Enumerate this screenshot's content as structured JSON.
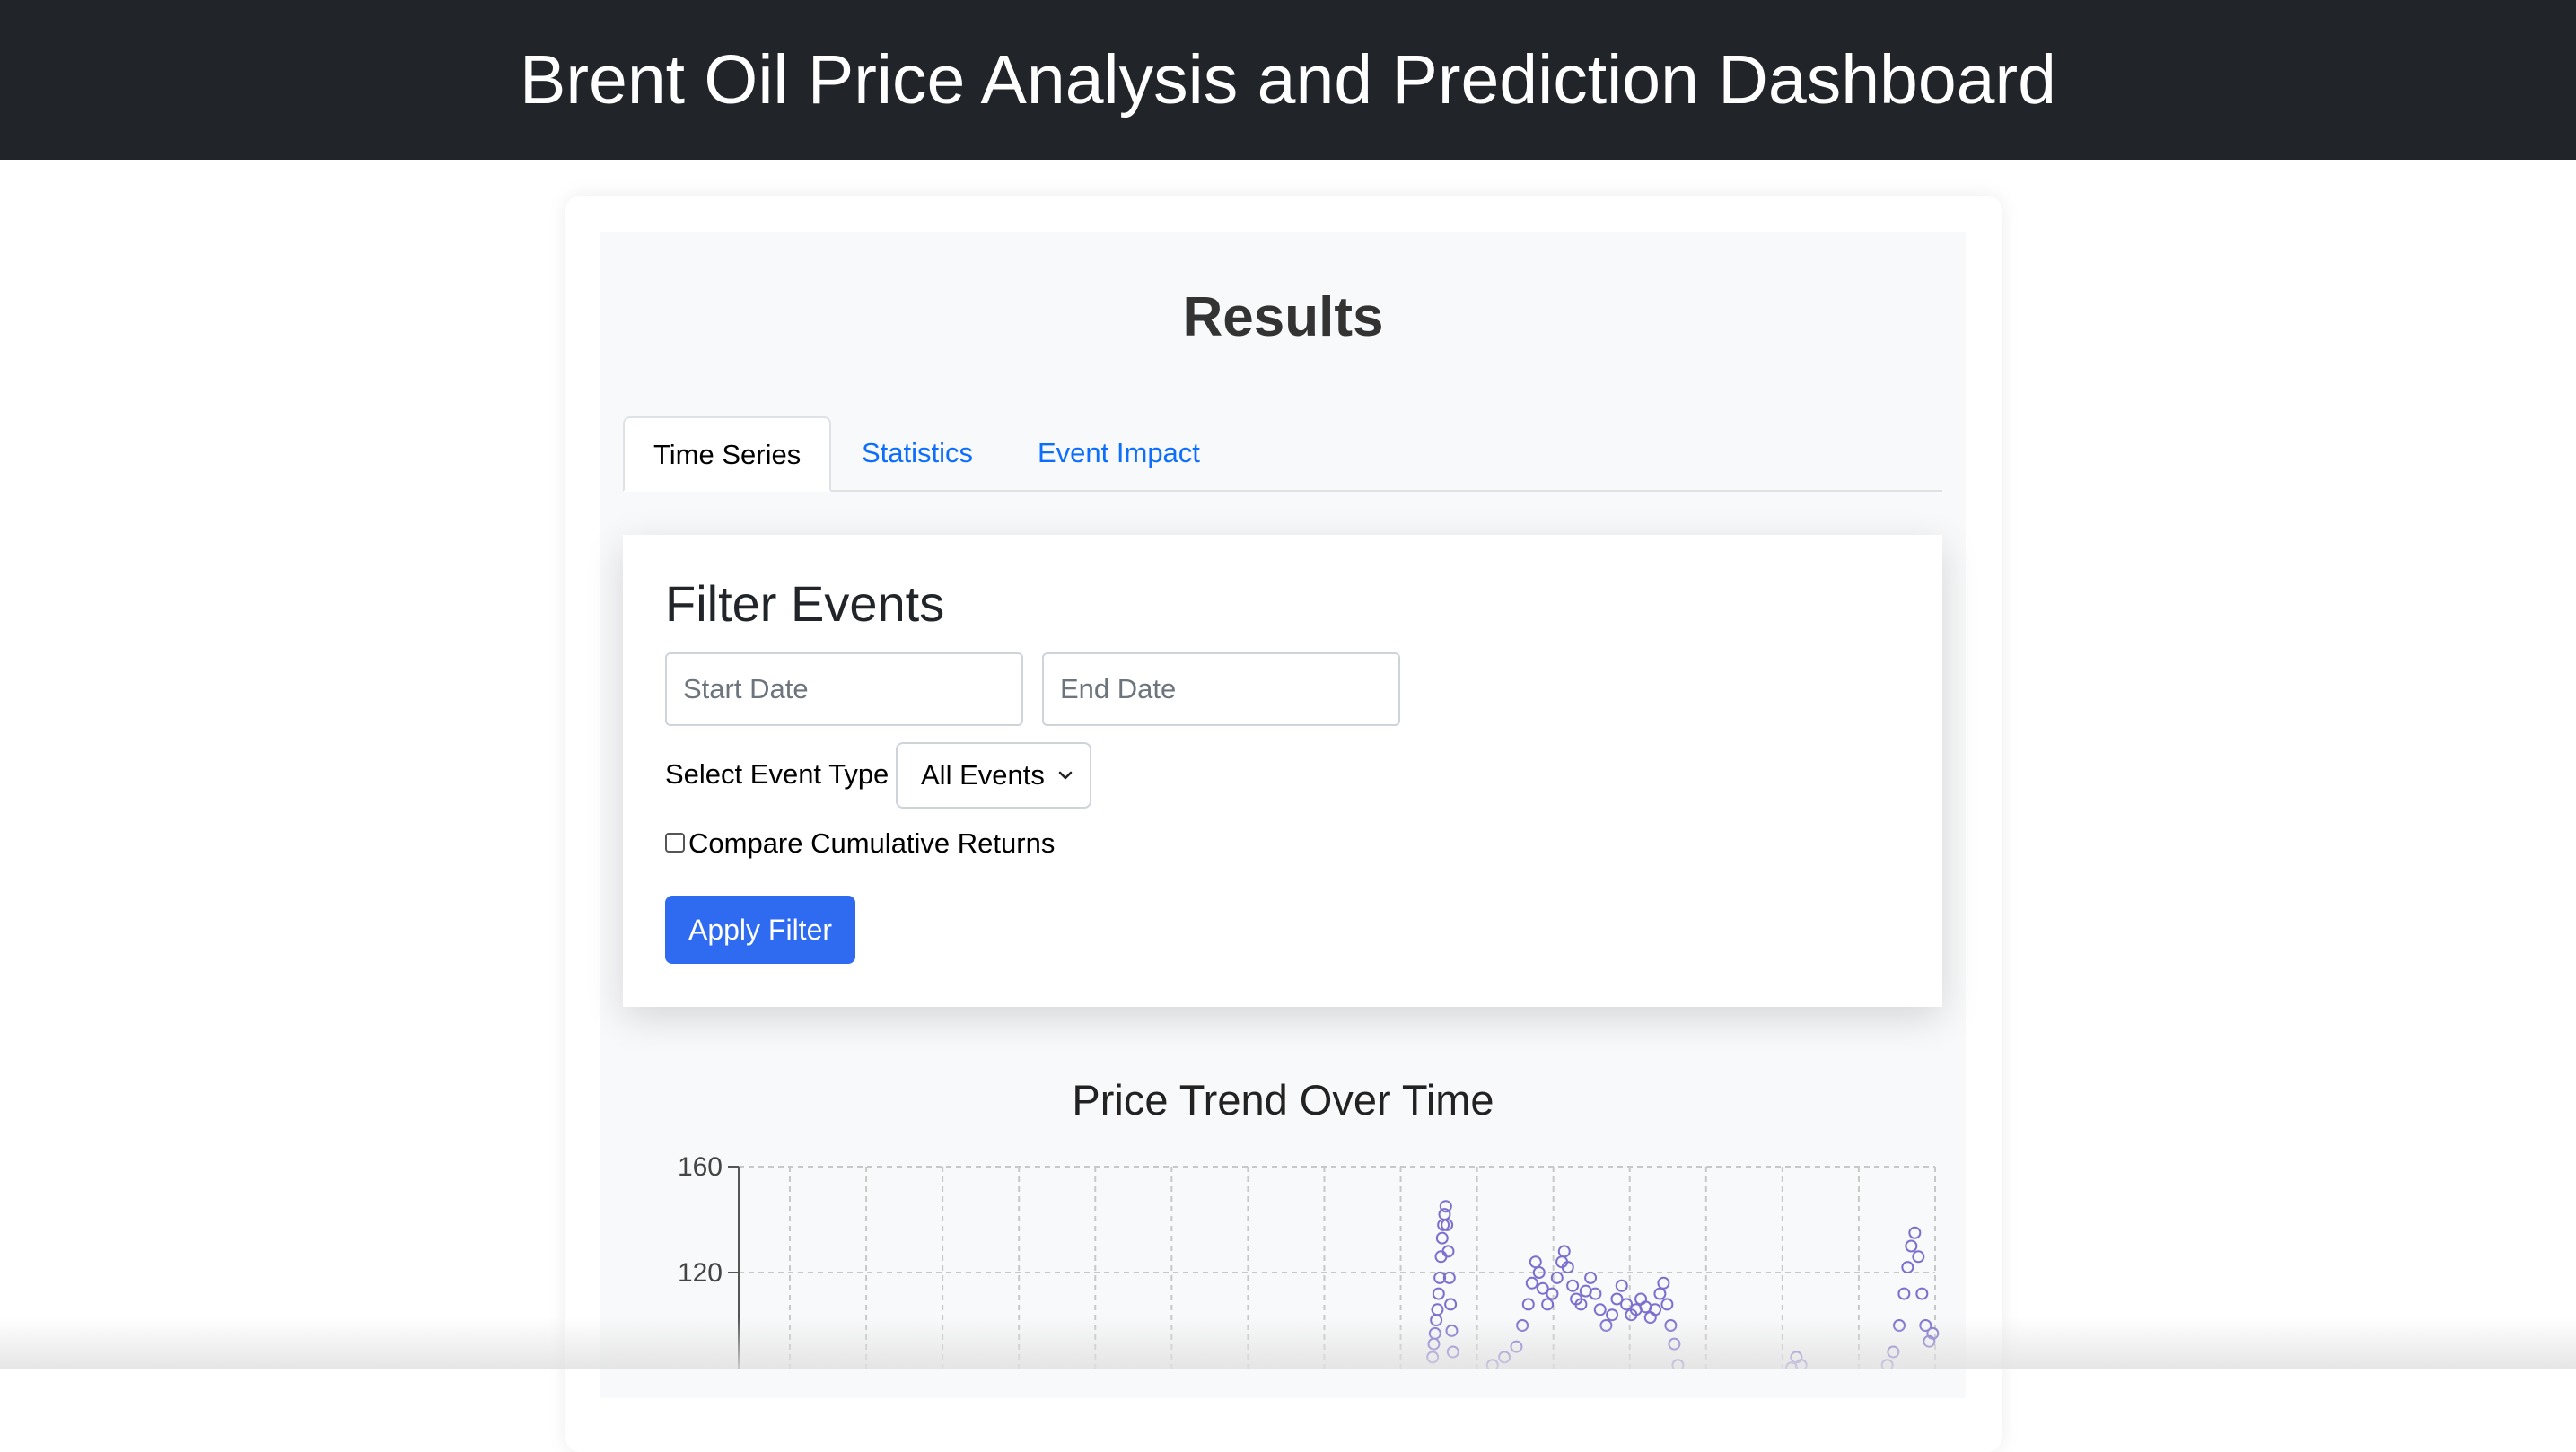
{
  "header": {
    "title": "Brent Oil Price Analysis and Prediction Dashboard"
  },
  "results": {
    "title": "Results"
  },
  "tabs": [
    {
      "label": "Time Series",
      "active": true
    },
    {
      "label": "Statistics",
      "active": false
    },
    {
      "label": "Event Impact",
      "active": false
    }
  ],
  "filter": {
    "title": "Filter Events",
    "start_date": {
      "value": "",
      "placeholder": "Start Date"
    },
    "end_date": {
      "value": "",
      "placeholder": "End Date"
    },
    "event_type_label": "Select Event Type",
    "event_type_selected": "All Events",
    "compare_label": "Compare Cumulative Returns",
    "compare_checked": false,
    "apply_label": "Apply Filter"
  },
  "colors": {
    "header_bg": "#212529",
    "accent": "#2f6bf0",
    "link": "#0d6efd",
    "series": "#7b6fd0"
  },
  "icons": {
    "select_arrow": "chevron-down-icon"
  },
  "chart_data": {
    "type": "scatter",
    "title": "Price Trend Over Time",
    "xlabel": "",
    "ylabel": "",
    "y_ticks": [
      120,
      160
    ],
    "ylim": [
      80,
      165
    ],
    "grid": true,
    "x_gridlines": 16,
    "series": [
      {
        "values": [
          [
            0.58,
            88
          ],
          [
            0.581,
            93
          ],
          [
            0.582,
            97
          ],
          [
            0.583,
            102
          ],
          [
            0.584,
            106
          ],
          [
            0.585,
            112
          ],
          [
            0.586,
            118
          ],
          [
            0.587,
            126
          ],
          [
            0.588,
            133
          ],
          [
            0.589,
            138
          ],
          [
            0.59,
            142
          ],
          [
            0.591,
            145
          ],
          [
            0.592,
            138
          ],
          [
            0.593,
            128
          ],
          [
            0.594,
            118
          ],
          [
            0.595,
            108
          ],
          [
            0.596,
            98
          ],
          [
            0.597,
            90
          ],
          [
            0.63,
            85
          ],
          [
            0.64,
            88
          ],
          [
            0.65,
            92
          ],
          [
            0.655,
            100
          ],
          [
            0.66,
            108
          ],
          [
            0.663,
            116
          ],
          [
            0.666,
            124
          ],
          [
            0.669,
            120
          ],
          [
            0.672,
            114
          ],
          [
            0.676,
            108
          ],
          [
            0.68,
            112
          ],
          [
            0.684,
            118
          ],
          [
            0.688,
            124
          ],
          [
            0.69,
            128
          ],
          [
            0.693,
            122
          ],
          [
            0.697,
            115
          ],
          [
            0.7,
            110
          ],
          [
            0.704,
            108
          ],
          [
            0.708,
            113
          ],
          [
            0.712,
            118
          ],
          [
            0.716,
            112
          ],
          [
            0.72,
            106
          ],
          [
            0.725,
            100
          ],
          [
            0.73,
            104
          ],
          [
            0.734,
            110
          ],
          [
            0.738,
            115
          ],
          [
            0.742,
            108
          ],
          [
            0.746,
            104
          ],
          [
            0.75,
            106
          ],
          [
            0.754,
            110
          ],
          [
            0.758,
            107
          ],
          [
            0.762,
            103
          ],
          [
            0.766,
            106
          ],
          [
            0.77,
            112
          ],
          [
            0.773,
            116
          ],
          [
            0.776,
            108
          ],
          [
            0.779,
            100
          ],
          [
            0.782,
            93
          ],
          [
            0.785,
            85
          ],
          [
            0.88,
            84
          ],
          [
            0.884,
            88
          ],
          [
            0.888,
            85
          ],
          [
            0.96,
            85
          ],
          [
            0.965,
            90
          ],
          [
            0.97,
            100
          ],
          [
            0.974,
            112
          ],
          [
            0.977,
            122
          ],
          [
            0.98,
            130
          ],
          [
            0.983,
            135
          ],
          [
            0.986,
            126
          ],
          [
            0.989,
            112
          ],
          [
            0.992,
            100
          ],
          [
            0.995,
            94
          ],
          [
            0.998,
            97
          ]
        ]
      }
    ]
  }
}
